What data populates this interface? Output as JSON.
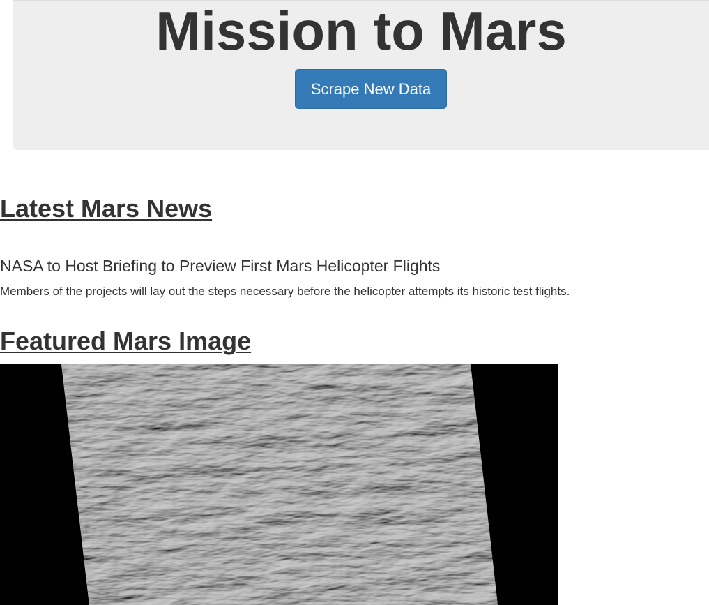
{
  "header": {
    "title": "Mission to Mars",
    "scrape_button_label": "Scrape New Data"
  },
  "news": {
    "heading": "Latest Mars News",
    "title": "NASA to Host Briefing to Preview First Mars Helicopter Flights",
    "teaser": "Members of the projects will lay out the steps necessary before the helicopter attempts its historic test flights."
  },
  "featured_image": {
    "heading": "Featured Mars Image"
  },
  "colors": {
    "jumbotron_bg": "#eeeeee",
    "button_bg": "#337ab7",
    "text": "#333333",
    "image_bg": "#000000"
  }
}
